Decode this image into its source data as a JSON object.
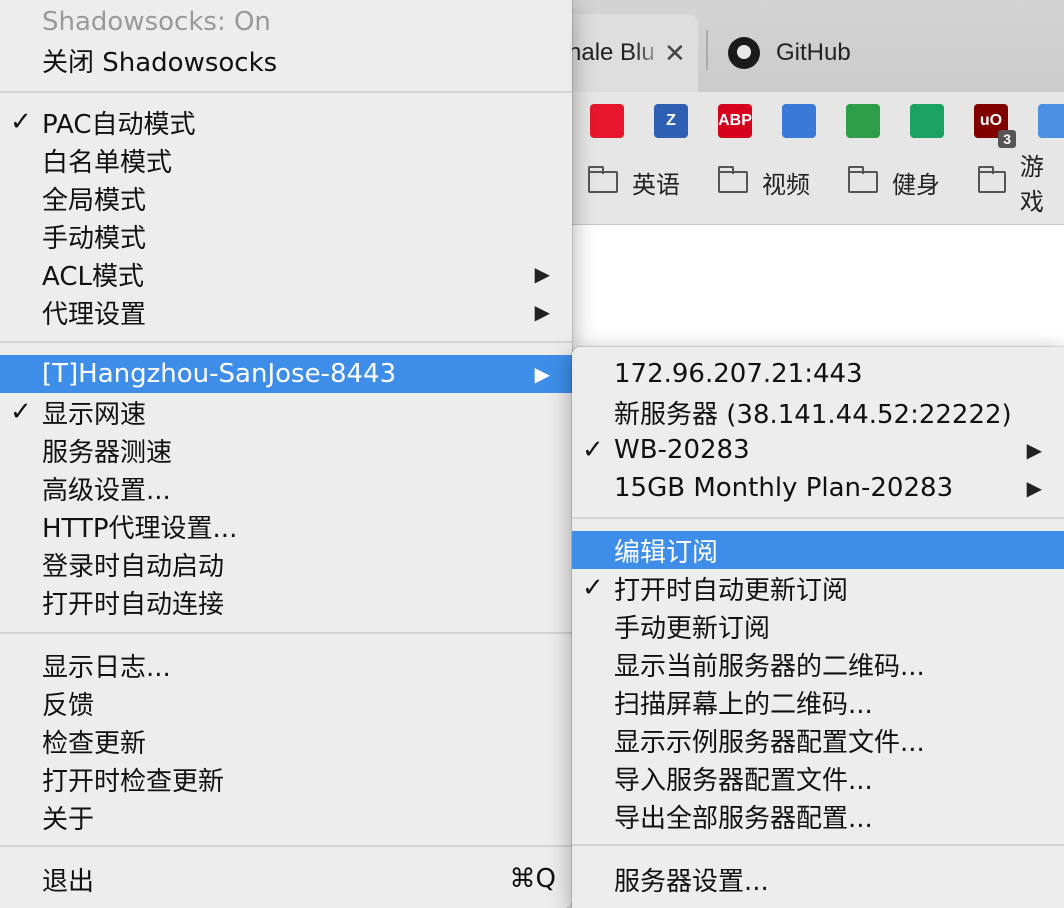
{
  "browser": {
    "tabs": [
      {
        "label": "hale Blu"
      },
      {
        "label": "GitHub"
      }
    ],
    "extensions": [
      {
        "icon": "weibo-icon",
        "text": "",
        "color": "#e6162d"
      },
      {
        "icon": "zotero-icon",
        "text": "Z",
        "color": "#2f5fb3"
      },
      {
        "icon": "adblock-plus-icon",
        "text": "ABP",
        "color": "#d6001c"
      },
      {
        "icon": "share-extension-icon",
        "text": "",
        "color": "#3a79d8"
      },
      {
        "icon": "download-extension-icon",
        "text": "",
        "color": "#2e9d47"
      },
      {
        "icon": "chat-extension-icon",
        "text": "",
        "color": "#1aa260"
      },
      {
        "icon": "ublock-icon",
        "text": "uO",
        "color": "#800000",
        "badge": "3"
      },
      {
        "icon": "puzzle-extension-icon",
        "text": "",
        "color": "#4a90e2"
      }
    ],
    "bookmarks": [
      "英语",
      "视频",
      "健身",
      "游戏"
    ]
  },
  "main_menu": {
    "status": "Shadowsocks: On",
    "toggle": "关闭 Shadowsocks",
    "modes": [
      {
        "label": "PAC自动模式",
        "checked": true,
        "submenu": false
      },
      {
        "label": "白名单模式",
        "checked": false,
        "submenu": false
      },
      {
        "label": "全局模式",
        "checked": false,
        "submenu": false
      },
      {
        "label": "手动模式",
        "checked": false,
        "submenu": false
      },
      {
        "label": "ACL模式",
        "checked": false,
        "submenu": true
      },
      {
        "label": "代理设置",
        "checked": false,
        "submenu": true
      }
    ],
    "server": {
      "label": "[T]Hangzhou-SanJose-8443",
      "submenu": true
    },
    "options": [
      {
        "label": "显示网速",
        "checked": true
      },
      {
        "label": "服务器测速",
        "checked": false
      },
      {
        "label": "高级设置...",
        "checked": false
      },
      {
        "label": "HTTP代理设置...",
        "checked": false
      },
      {
        "label": "登录时自动启动",
        "checked": false
      },
      {
        "label": "打开时自动连接",
        "checked": false
      }
    ],
    "misc": [
      "显示日志...",
      "反馈",
      "检查更新",
      "打开时检查更新",
      "关于"
    ],
    "quit": {
      "label": "退出",
      "shortcut": "⌘Q"
    }
  },
  "server_submenu": {
    "servers": [
      {
        "label": "172.96.207.21:443",
        "checked": false,
        "submenu": false
      },
      {
        "label": "新服务器 (38.141.44.52:22222)",
        "checked": false,
        "submenu": false
      },
      {
        "label": "WB-20283",
        "checked": true,
        "submenu": true
      },
      {
        "label": "15GB Monthly Plan-20283",
        "checked": false,
        "submenu": true
      }
    ],
    "actions": [
      {
        "label": "编辑订阅",
        "checked": false,
        "selected": true
      },
      {
        "label": "打开时自动更新订阅",
        "checked": true,
        "selected": false
      },
      {
        "label": "手动更新订阅",
        "checked": false,
        "selected": false
      },
      {
        "label": "显示当前服务器的二维码...",
        "checked": false,
        "selected": false
      },
      {
        "label": "扫描屏幕上的二维码...",
        "checked": false,
        "selected": false
      },
      {
        "label": "显示示例服务器配置文件...",
        "checked": false,
        "selected": false
      },
      {
        "label": "导入服务器配置文件...",
        "checked": false,
        "selected": false
      },
      {
        "label": "导出全部服务器配置...",
        "checked": false,
        "selected": false
      }
    ],
    "settings": "服务器设置..."
  },
  "symbols": {
    "check": "✓",
    "submenu_arrow": "▶",
    "close": "✕"
  }
}
